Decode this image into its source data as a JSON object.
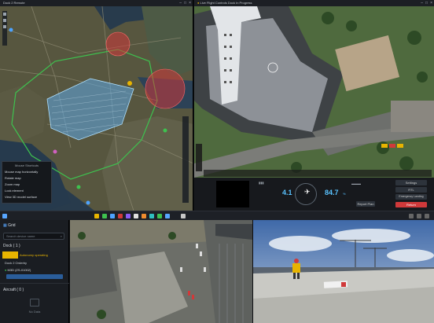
{
  "window1": {
    "title": "Dock 2 Remote",
    "context_menu": {
      "title": "Mouse Shortcuts",
      "items": [
        "Mouse map horizontally",
        "Rotate map",
        "Zoom map",
        "Lock element",
        "View 3D model surface"
      ]
    }
  },
  "window2": {
    "title": "Live Flight Controls Dock In Progress",
    "telemetry": {
      "left_value": "4.1",
      "right_value": "84.7",
      "right_unit": "%"
    },
    "buttons": {
      "settings": "Settings",
      "rtl": "RTL",
      "emergency": "Emergency Landing",
      "resume": "Return",
      "report": "Report Plan"
    }
  },
  "device_panel": {
    "header_label": "Grid",
    "search_placeholder": "Search device name",
    "dock_section": "Dock ( 1 )",
    "dock_name": "Dock 2 Orderby",
    "dock_status": "Autonomy operating",
    "aircraft_entry": "M3D (ZS-01002)",
    "aircraft_section": "Aircraft ( 0 )",
    "no_data": "No Data"
  },
  "colors": {
    "accent_yellow": "#e8b400",
    "danger_red": "#d0393a",
    "map_blue": "#5fa9e6",
    "area_green": "#3ec24f"
  }
}
